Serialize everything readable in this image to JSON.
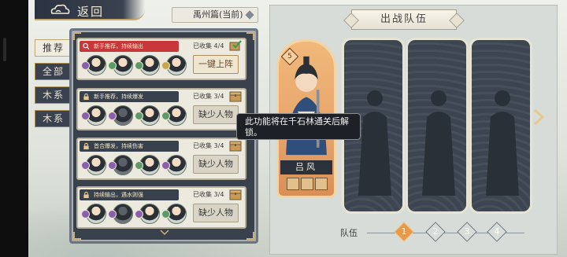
{
  "header": {
    "back_label": "返回",
    "chapter": "禹州篇(当前)"
  },
  "side_tabs": [
    {
      "label": "推荐",
      "active": true
    },
    {
      "label": "全部",
      "active": false
    },
    {
      "label": "木系",
      "active": false
    },
    {
      "label": "木系",
      "active": false
    }
  ],
  "team_list": [
    {
      "tag": "新手推荐，持续输出",
      "tag_color": "#c8383a",
      "collected": "已收集 4/4",
      "button": "一键上阵",
      "primary": true
    },
    {
      "tag": "新手推荐，持续爆发",
      "tag_color": "#39414d",
      "collected": "已收集 3/4",
      "button": "缺少人物",
      "primary": false
    },
    {
      "tag": "首合爆发，持续伤害",
      "tag_color": "#39414d",
      "collected": "已收集 3/4",
      "button": "缺少人物",
      "primary": false
    },
    {
      "tag": "持续输出，遇水则强",
      "tag_color": "#39414d",
      "collected": "已收集 3/4",
      "button": "缺少人物",
      "primary": false
    }
  ],
  "lineup": {
    "title": "出战队伍",
    "hero": {
      "name": "吕风",
      "level": "5"
    },
    "team_label": "队伍",
    "teams": [
      "1",
      "2",
      "3",
      "4"
    ],
    "active_team": "1"
  },
  "tooltip": {
    "text": "此功能将在千石林通关后解锁。"
  },
  "colors": {
    "panel_dark": "#39414d",
    "accent_gold": "#c7a86a",
    "hero_orange": "#e7a46a",
    "tag_red": "#c8383a"
  }
}
